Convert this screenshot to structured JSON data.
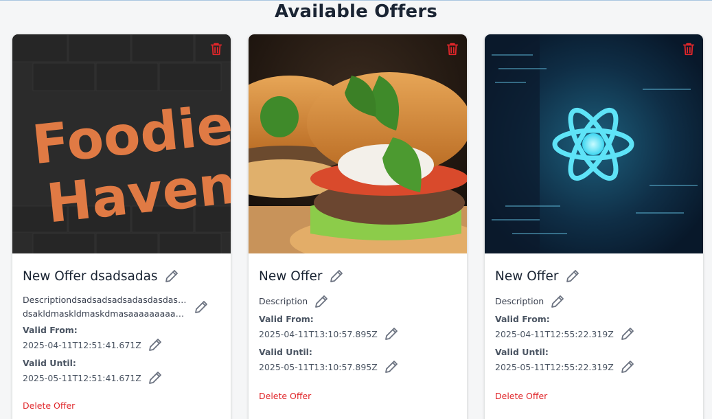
{
  "page": {
    "title": "Available Offers"
  },
  "colors": {
    "danger": "#e0262a",
    "icon_gray": "#6b7280",
    "title": "#1a2433"
  },
  "offers": [
    {
      "title": "New Offer dsadsadas",
      "description_lines": [
        "Descriptiondsadsadsadsadasdasdasd...",
        "dsakldmaskldmaskdmasaaaaaaaaaaa..."
      ],
      "valid_from_label": "Valid From:",
      "valid_from": "2025-04-11T12:51:41.671Z",
      "valid_until_label": "Valid Until:",
      "valid_until": "2025-05-11T12:51:41.671Z",
      "delete_label": "Delete Offer",
      "image": {
        "type": "logo",
        "text_line1": "Foodie",
        "text_line2": "Haven"
      }
    },
    {
      "title": "New Offer",
      "description_lines": [
        "Description"
      ],
      "valid_from_label": "Valid From:",
      "valid_from": "2025-04-11T13:10:57.895Z",
      "valid_until_label": "Valid Until:",
      "valid_until": "2025-05-11T13:10:57.895Z",
      "delete_label": "Delete Offer",
      "image": {
        "type": "photo",
        "subject": "burger"
      }
    },
    {
      "title": "New Offer",
      "description_lines": [
        "Description"
      ],
      "valid_from_label": "Valid From:",
      "valid_from": "2025-04-11T12:55:22.319Z",
      "valid_until_label": "Valid Until:",
      "valid_until": "2025-05-11T12:55:22.319Z",
      "delete_label": "Delete Offer",
      "image": {
        "type": "illustration",
        "subject": "react-atom"
      }
    }
  ],
  "icons": {
    "edit": "pencil-icon",
    "delete": "trash-icon"
  }
}
